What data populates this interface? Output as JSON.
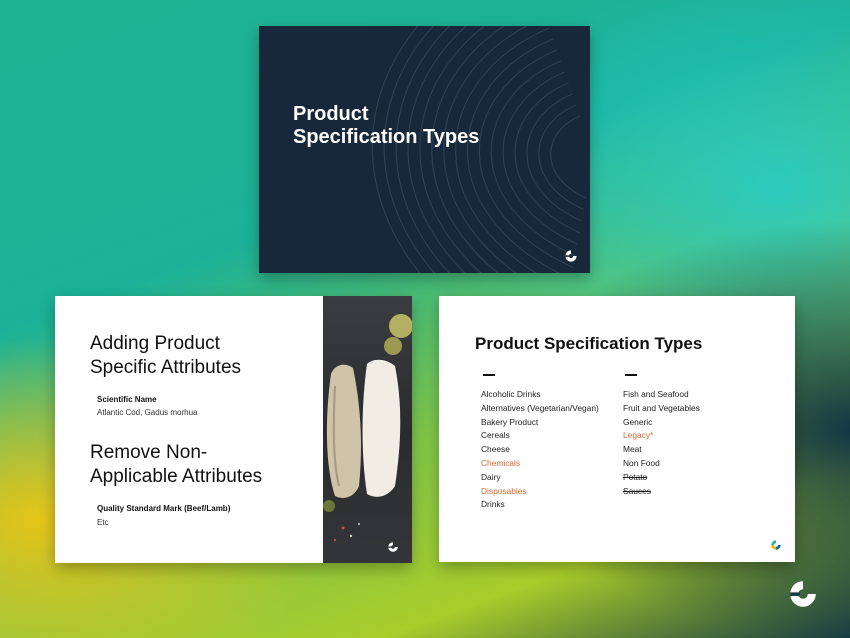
{
  "top_slide": {
    "title_line1": "Product",
    "title_line2": "Specification Types"
  },
  "left_slide": {
    "heading1_line1": "Adding Product",
    "heading1_line2": "Specific Attributes",
    "label1": "Scientific Name",
    "value1": "Atlantic Cod, Gadus morhua",
    "heading2_line1": "Remove Non-",
    "heading2_line2": "Applicable Attributes",
    "label2": "Quality Standard Mark (Beef/Lamb)",
    "value2": "Etc"
  },
  "right_slide": {
    "title": "Product Specification Types",
    "column1": [
      {
        "text": "Alcoholic Drinks",
        "style": "normal"
      },
      {
        "text": "Alternatives (Vegetarian/Vegan)",
        "style": "normal"
      },
      {
        "text": "Bakery Product",
        "style": "normal"
      },
      {
        "text": "Cereals",
        "style": "normal"
      },
      {
        "text": "Cheese",
        "style": "normal"
      },
      {
        "text": "Chemicals",
        "style": "orange"
      },
      {
        "text": "Dairy",
        "style": "normal"
      },
      {
        "text": "Disposables",
        "style": "orange"
      },
      {
        "text": "Drinks",
        "style": "normal"
      }
    ],
    "column2": [
      {
        "text": "Fish and Seafood",
        "style": "normal"
      },
      {
        "text": "Fruit and Vegetables",
        "style": "normal"
      },
      {
        "text": "Generic",
        "style": "normal"
      },
      {
        "text": "Legacy*",
        "style": "orange"
      },
      {
        "text": "Meat",
        "style": "normal"
      },
      {
        "text": "Non Food",
        "style": "normal"
      },
      {
        "text": "Potato",
        "style": "struck"
      },
      {
        "text": "Sauces",
        "style": "struck"
      }
    ]
  },
  "colors": {
    "dark_slide": "#17283a",
    "accent_orange": "#d9692f"
  },
  "icons": [
    "brand-logo-icon"
  ]
}
